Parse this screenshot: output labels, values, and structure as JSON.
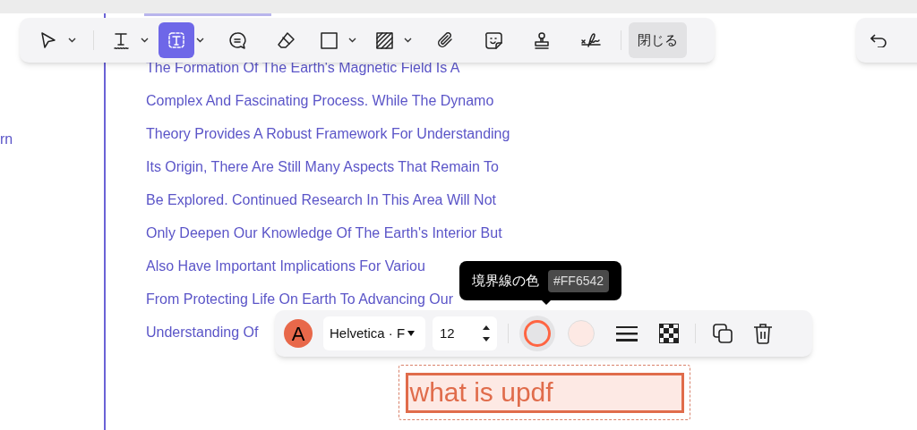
{
  "sidebar": {
    "fragments": [
      "rn"
    ]
  },
  "toolbar": {
    "tools": [
      {
        "kind": "select",
        "selected": false,
        "dropdown": true
      },
      {
        "kind": "text",
        "selected": false,
        "dropdown": true
      },
      {
        "kind": "textbox",
        "selected": true,
        "dropdown": true
      },
      {
        "kind": "comment",
        "selected": false,
        "dropdown": false
      },
      {
        "kind": "eraser",
        "selected": false,
        "dropdown": false
      },
      {
        "kind": "rectangle",
        "selected": false,
        "dropdown": true
      },
      {
        "kind": "hatch",
        "selected": false,
        "dropdown": true
      },
      {
        "kind": "attach",
        "selected": false,
        "dropdown": false
      },
      {
        "kind": "sticker",
        "selected": false,
        "dropdown": false
      },
      {
        "kind": "stamp",
        "selected": false,
        "dropdown": false
      },
      {
        "kind": "signature",
        "selected": false,
        "dropdown": false
      }
    ],
    "close_button": "閉じる"
  },
  "document": {
    "lines": [
      "The Formation Of The Earth's Magnetic Field Is A",
      "Complex And Fascinating Process. While The Dynamo",
      "Theory Provides A Robust Framework For Understanding",
      "Its Origin, There Are Still Many Aspects That Remain To",
      "Be Explored. Continued Research In This Area Will Not",
      "Only Deepen Our Knowledge Of The Earth's Interior But",
      "Also Have Important Implications For Variou",
      "From Protecting Life On Earth To Advancing Our",
      "Understanding Of"
    ]
  },
  "format_bar": {
    "font_color_letter": "A",
    "font": "Helvetica · F",
    "size": "12"
  },
  "tooltip": {
    "label": "境界線の色",
    "value": "#FF6542"
  },
  "text_box": {
    "text": "what is updf"
  }
}
